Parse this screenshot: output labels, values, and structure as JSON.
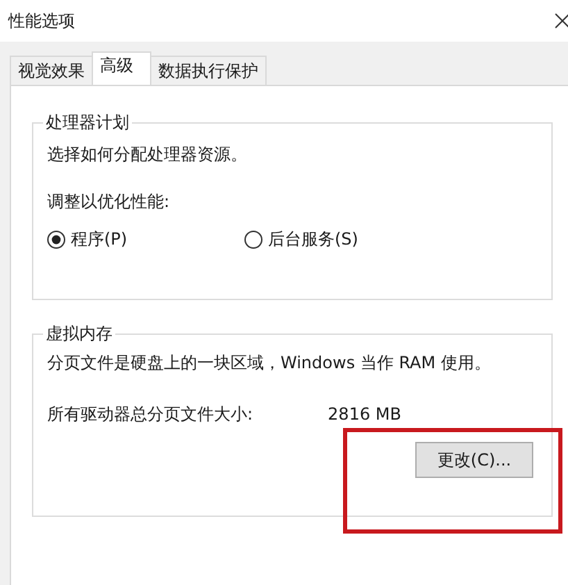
{
  "window": {
    "title": "性能选项"
  },
  "tabs": [
    {
      "label": "视觉效果",
      "selected": false
    },
    {
      "label": "高级",
      "selected": true
    },
    {
      "label": "数据执行保护",
      "selected": false
    }
  ],
  "processor_scheduling": {
    "legend": "处理器计划",
    "description": "选择如何分配处理器资源。",
    "prompt": "调整以优化性能:",
    "options": [
      {
        "label": "程序(P)",
        "selected": true
      },
      {
        "label": "后台服务(S)",
        "selected": false
      }
    ]
  },
  "virtual_memory": {
    "legend": "虚拟内存",
    "description": "分页文件是硬盘上的一块区域，Windows 当作 RAM 使用。",
    "total_label": "所有驱动器总分页文件大小:",
    "total_value": "2816 MB",
    "button": "更改(C)..."
  }
}
